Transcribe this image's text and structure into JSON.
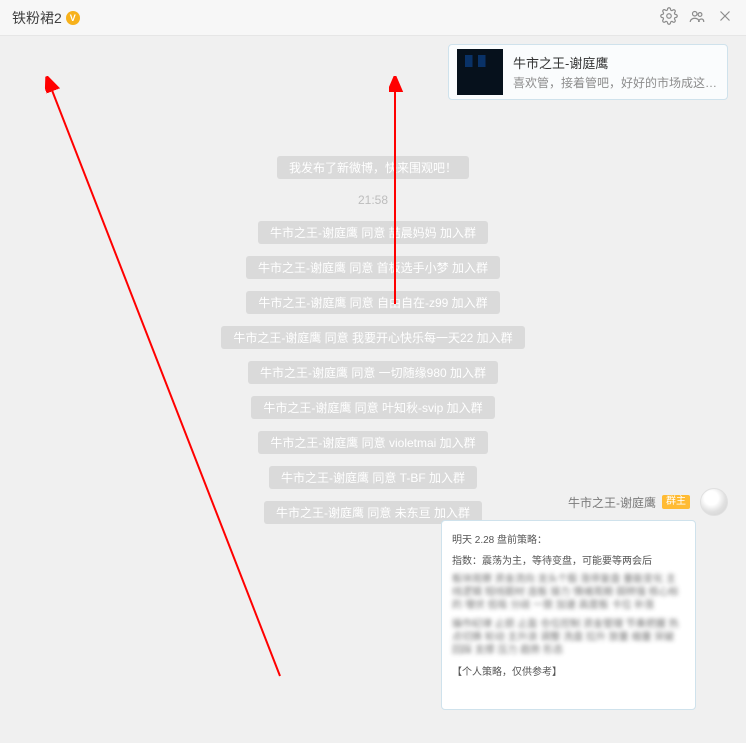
{
  "header": {
    "title": "铁粉裙2",
    "badge": "V"
  },
  "card": {
    "title": "牛市之王-谢庭鹰",
    "subtitle": "喜欢管，接着管吧，好好的市场成这样..."
  },
  "banner": "我发布了新微博，快来围观吧！",
  "timestamp": "21:58",
  "systemMsgs": [
    "牛市之王-谢庭鹰 同意 喆晨妈妈 加入群",
    "牛市之王-谢庭鹰 同意 首板选手小梦 加入群",
    "牛市之王-谢庭鹰 同意 自由自在-z99 加入群",
    "牛市之王-谢庭鹰 同意 我要开心快乐每一天22 加入群",
    "牛市之王-谢庭鹰 同意 一切随缘980 加入群",
    "牛市之王-谢庭鹰 同意 叶知秋-svip 加入群",
    "牛市之王-谢庭鹰 同意 violetmai 加入群",
    "牛市之王-谢庭鹰 同意 T-BF 加入群",
    "牛市之王-谢庭鹰 同意 未东亘 加入群"
  ],
  "sender": {
    "name": "牛市之王-谢庭鹰",
    "tag": "群主"
  },
  "doc": {
    "line1": "明天 2.28 盘前策略：",
    "line2": "指数：震荡为主，等待变盘，可能要等两会后",
    "footer": "【个人策略，仅供参考】"
  }
}
